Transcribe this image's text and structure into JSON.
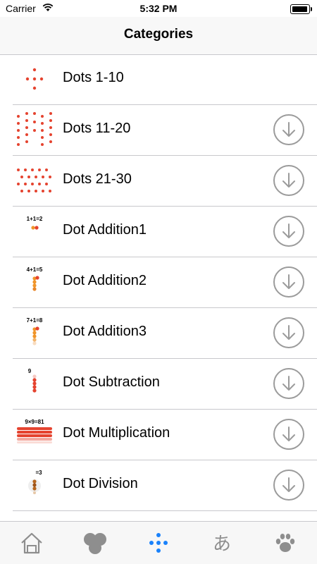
{
  "status_bar": {
    "carrier": "Carrier",
    "time": "5:32 PM"
  },
  "nav": {
    "title": "Categories"
  },
  "categories": [
    {
      "label": "Dots 1-10",
      "thumb_text": "",
      "downloadable": false
    },
    {
      "label": "Dots 11-20",
      "thumb_text": "",
      "downloadable": true
    },
    {
      "label": "Dots 21-30",
      "thumb_text": "",
      "downloadable": true
    },
    {
      "label": "Dot Addition1",
      "thumb_text": "1+1=2",
      "downloadable": true
    },
    {
      "label": "Dot Addition2",
      "thumb_text": "4+1=5",
      "downloadable": true
    },
    {
      "label": "Dot Addition3",
      "thumb_text": "7+1=8",
      "downloadable": true
    },
    {
      "label": "Dot Subtraction",
      "thumb_text": "9",
      "downloadable": true
    },
    {
      "label": "Dot Multiplication",
      "thumb_text": "9×9=81",
      "downloadable": true
    },
    {
      "label": "Dot Division",
      "thumb_text": "=3",
      "downloadable": true
    }
  ],
  "tabs": [
    {
      "name": "home-icon",
      "active": false
    },
    {
      "name": "shapes-icon",
      "active": false
    },
    {
      "name": "dots-icon",
      "active": true
    },
    {
      "name": "hiragana-icon",
      "active": false,
      "glyph": "あ"
    },
    {
      "name": "paw-icon",
      "active": false
    }
  ],
  "colors": {
    "dot_red": "#e5432f",
    "dot_orange": "#f0952a",
    "accent": "#1a82fb",
    "icon_gray": "#8e8e8e",
    "separator": "#c8c8cc"
  }
}
